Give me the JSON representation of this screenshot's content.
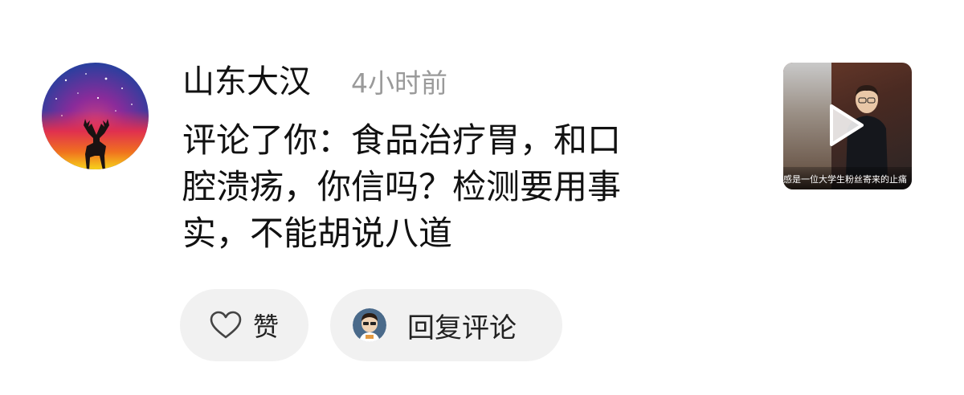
{
  "comment": {
    "username": "山东大汉",
    "time": "4小时前",
    "lines": [
      "评论了你：食品治疗胃，和口",
      "腔溃疡，你信吗？检测要用事",
      "实，不能胡说八道"
    ]
  },
  "thumbnail": {
    "caption": "感是一位大学生粉丝寄来的止痛",
    "play_icon": "play-icon"
  },
  "actions": {
    "like_label": "赞",
    "reply_label": "回复评论",
    "like_icon": "heart-outline-icon"
  }
}
